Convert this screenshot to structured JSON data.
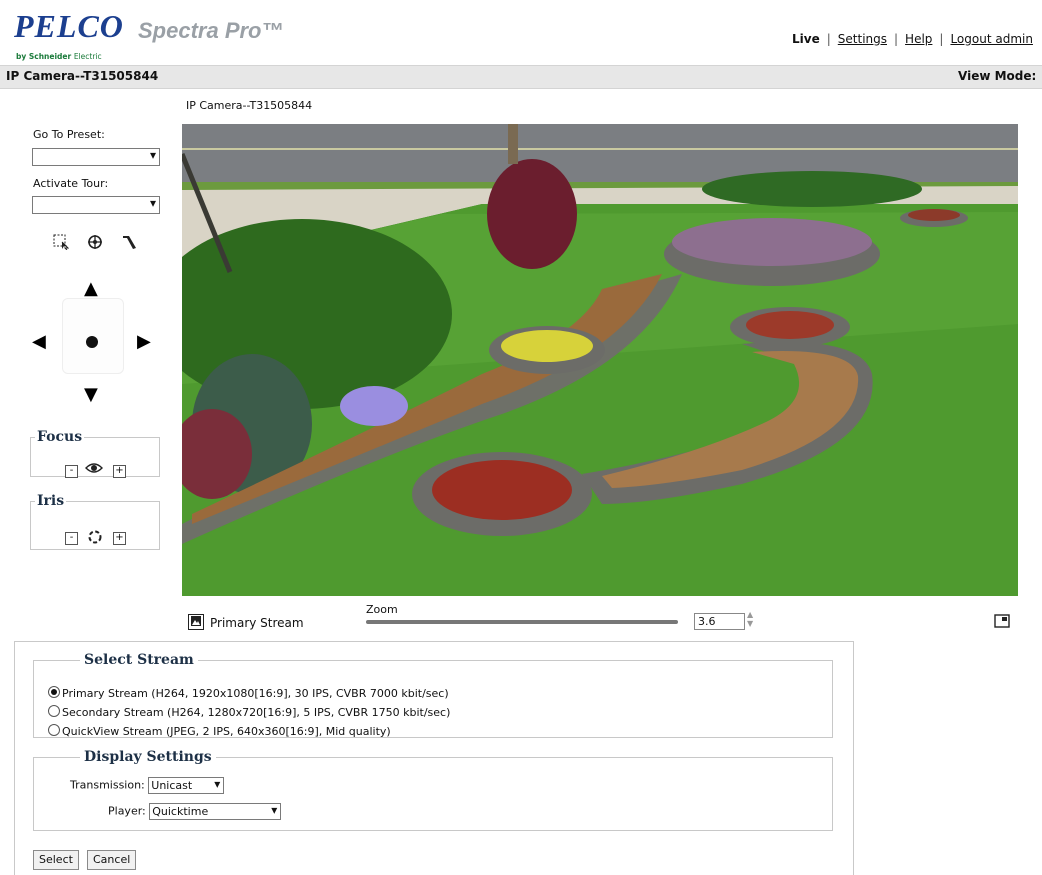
{
  "header": {
    "brand": "PELCO",
    "product": "Spectra Pro™",
    "by": "by Schneider",
    "by_suffix": "Electric",
    "nav": {
      "live": "Live",
      "settings": "Settings",
      "help": "Help",
      "logout": "Logout admin"
    }
  },
  "titlebar": {
    "camera": "IP Camera--T31505844",
    "view_mode_label": "View Mode:"
  },
  "left": {
    "preset_label": "Go To Preset:",
    "preset_value": "",
    "tour_label": "Activate Tour:",
    "tour_value": "",
    "focus_legend": "Focus",
    "iris_legend": "Iris",
    "minus": "-",
    "plus": "+"
  },
  "video": {
    "title": "IP Camera--T31505844",
    "stream_label": "Primary Stream",
    "zoom_label": "Zoom",
    "zoom_value": "3.6",
    "zoom_level_fraction": 0.0
  },
  "select_stream": {
    "legend": "Select Stream",
    "options": [
      {
        "label": "Primary Stream (H264, 1920x1080[16:9], 30 IPS, CVBR 7000 kbit/sec)",
        "selected": true
      },
      {
        "label": "Secondary Stream (H264, 1280x720[16:9], 5 IPS, CVBR 1750 kbit/sec)",
        "selected": false
      },
      {
        "label": "QuickView Stream (JPEG, 2 IPS, 640x360[16:9], Mid quality)",
        "selected": false
      }
    ]
  },
  "display_settings": {
    "legend": "Display Settings",
    "transmission_label": "Transmission:",
    "transmission_value": "Unicast",
    "player_label": "Player:",
    "player_value": "Quicktime"
  },
  "buttons": {
    "select": "Select",
    "cancel": "Cancel"
  },
  "icons": {
    "chevron": "▾",
    "up": "▲",
    "down": "▼",
    "left": "◀",
    "right": "▶"
  }
}
